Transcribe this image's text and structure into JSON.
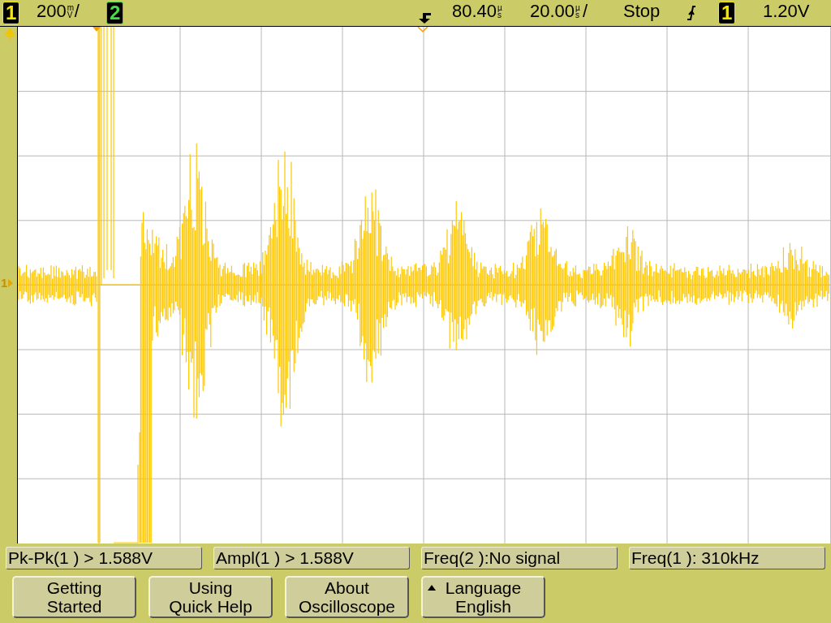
{
  "status_bar": {
    "channel_1": {
      "label": "1",
      "color": "#f5e800"
    },
    "volts_per_div": {
      "value": "200",
      "unit": "mV",
      "suffix": "/"
    },
    "channel_2": {
      "label": "2",
      "color": "#44dd44"
    },
    "delay": {
      "value": "80.40",
      "unit": "µs"
    },
    "time_per_div": {
      "value": "20.00",
      "unit": "µs",
      "suffix": "/"
    },
    "run_state": "Stop",
    "trigger_source": {
      "label": "1",
      "color": "#f5e800"
    },
    "trigger_level": "1.20V"
  },
  "display": {
    "ground_marker": "1"
  },
  "measurements": [
    "Pk-Pk(1 ) > 1.588V",
    "Ampl(1 ) > 1.588V",
    "Freq(2 ):No signal",
    "Freq(1 ): 310kHz"
  ],
  "softkeys": [
    {
      "lines": [
        "Getting",
        "Started"
      ],
      "arrow": false
    },
    {
      "lines": [
        "Using",
        "Quick Help"
      ],
      "arrow": false
    },
    {
      "lines": [
        "About",
        "Oscilloscope"
      ],
      "arrow": false
    },
    {
      "lines": [
        "Language",
        "English"
      ],
      "arrow": true
    }
  ]
}
